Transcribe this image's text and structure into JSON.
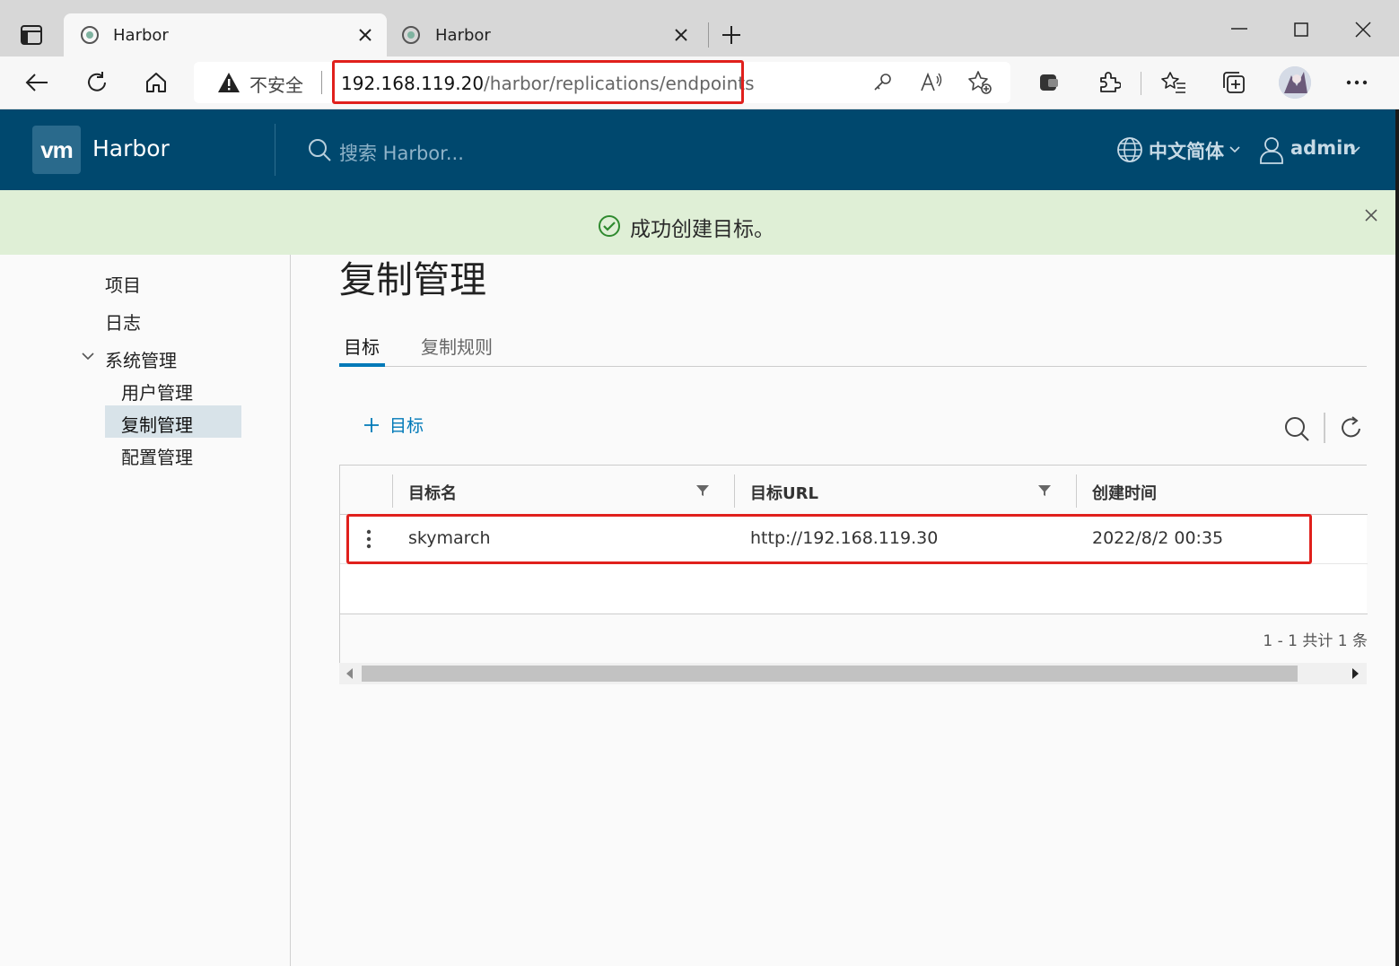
{
  "browser": {
    "tabs": [
      {
        "title": "Harbor",
        "active": true
      },
      {
        "title": "Harbor",
        "active": false
      }
    ],
    "security_label": "不安全",
    "url_host": "192.168.119.20",
    "url_path": "/harbor/replications/endpoints"
  },
  "header": {
    "logo_text": "vm",
    "app_title": "Harbor",
    "search_placeholder": "搜索 Harbor...",
    "language": "中文简体",
    "user": "admin"
  },
  "alert": {
    "message": "成功创建目标。"
  },
  "sidebar": {
    "items": [
      {
        "label": "项目"
      },
      {
        "label": "日志"
      },
      {
        "label": "系统管理"
      }
    ],
    "sub_items": [
      {
        "label": "用户管理"
      },
      {
        "label": "复制管理",
        "active": true
      },
      {
        "label": "配置管理"
      }
    ]
  },
  "main": {
    "title": "复制管理",
    "tabs": [
      {
        "label": "目标",
        "active": true
      },
      {
        "label": "复制规则",
        "active": false
      }
    ],
    "add_button": "目标",
    "grid": {
      "columns": [
        "目标名",
        "目标URL",
        "创建时间"
      ],
      "rows": [
        {
          "name": "skymarch",
          "url": "http://192.168.119.30",
          "created": "2022/8/2 00:35"
        }
      ],
      "pagination": "1 - 1 共计 1 条"
    }
  },
  "colors": {
    "header_bg": "#00486e",
    "alert_bg": "#dfefd6",
    "accent": "#0079b8",
    "highlight": "#e0201c"
  }
}
